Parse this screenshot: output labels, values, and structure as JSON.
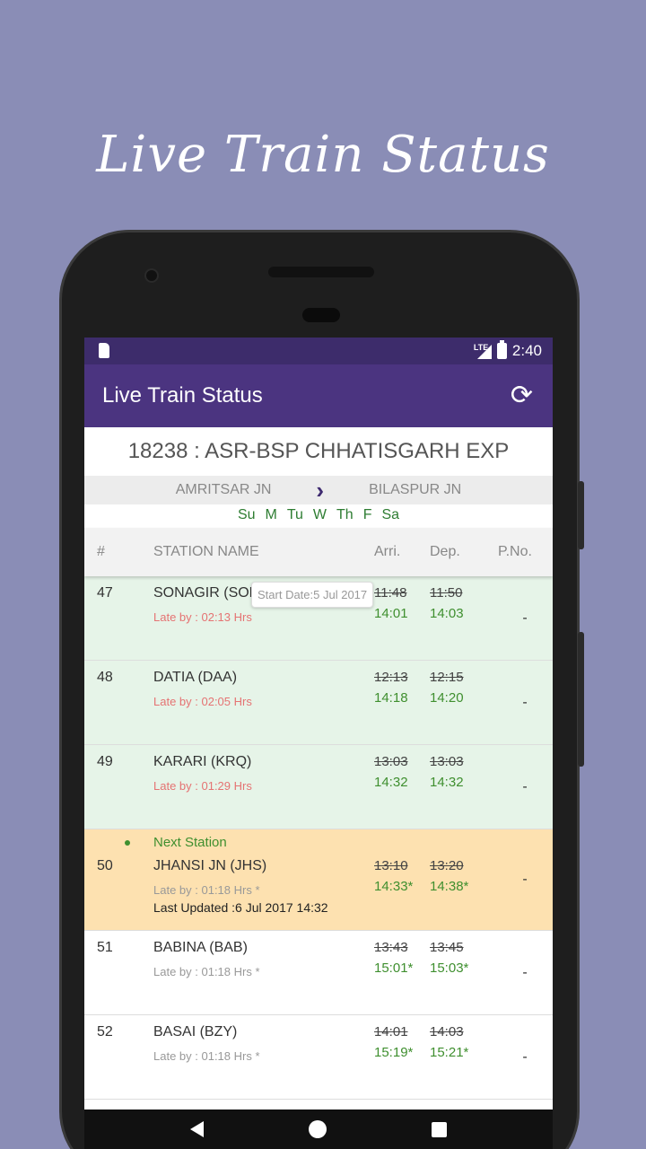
{
  "promo": {
    "title": "Live Train Status"
  },
  "status_bar": {
    "time": "2:40",
    "network": "LTE"
  },
  "app_bar": {
    "title": "Live Train Status",
    "refresh_icon": "refresh-icon"
  },
  "train": {
    "title": "18238 : ASR-BSP CHHATISGARH EXP",
    "from": "AMRITSAR JN",
    "to": "BILASPUR JN",
    "days": [
      "Su",
      "M",
      "Tu",
      "W",
      "Th",
      "F",
      "Sa"
    ]
  },
  "table": {
    "headers": {
      "num": "#",
      "name": "STATION NAME",
      "arr": "Arri.",
      "dep": "Dep.",
      "pno": "P.No."
    },
    "tooltip": "Start Date:5 Jul 2017",
    "rows": [
      {
        "num": "47",
        "station": "SONAGIR (SOR)",
        "late": "Late by : 02:13 Hrs",
        "sched_arr": "11:48",
        "sched_dep": "11:50",
        "act_arr": "14:01",
        "act_dep": "14:03",
        "pno": "-"
      },
      {
        "num": "48",
        "station": "DATIA (DAA)",
        "late": "Late by : 02:05 Hrs",
        "sched_arr": "12:13",
        "sched_dep": "12:15",
        "act_arr": "14:18",
        "act_dep": "14:20",
        "pno": "-"
      },
      {
        "num": "49",
        "station": "KARARI (KRQ)",
        "late": "Late by : 01:29 Hrs",
        "sched_arr": "13:03",
        "sched_dep": "13:03",
        "act_arr": "14:32",
        "act_dep": "14:32",
        "pno": "-"
      },
      {
        "num": "50",
        "next_label": "Next Station",
        "station": "JHANSI JN (JHS)",
        "late": "Late by : 01:18 Hrs *",
        "updated": "Last Updated :6 Jul 2017 14:32",
        "sched_arr": "13:10",
        "sched_dep": "13:20",
        "act_arr": "14:33*",
        "act_dep": "14:38*",
        "pno": "-"
      },
      {
        "num": "51",
        "station": "BABINA (BAB)",
        "late": "Late by : 01:18 Hrs *",
        "sched_arr": "13:43",
        "sched_dep": "13:45",
        "act_arr": "15:01*",
        "act_dep": "15:03*",
        "pno": "-"
      },
      {
        "num": "52",
        "station": "BASAI (BZY)",
        "late": "Late by : 01:18 Hrs *",
        "sched_arr": "14:01",
        "sched_dep": "14:03",
        "act_arr": "15:19*",
        "act_dep": "15:21*",
        "pno": "-"
      }
    ]
  },
  "colors": {
    "background": "#8a8db6",
    "status_bar": "#3d2c6b",
    "app_bar": "#4b3480",
    "green_row": "#e6f4e8",
    "next_row": "#fde1b0",
    "actual_time": "#3f8f2f"
  }
}
